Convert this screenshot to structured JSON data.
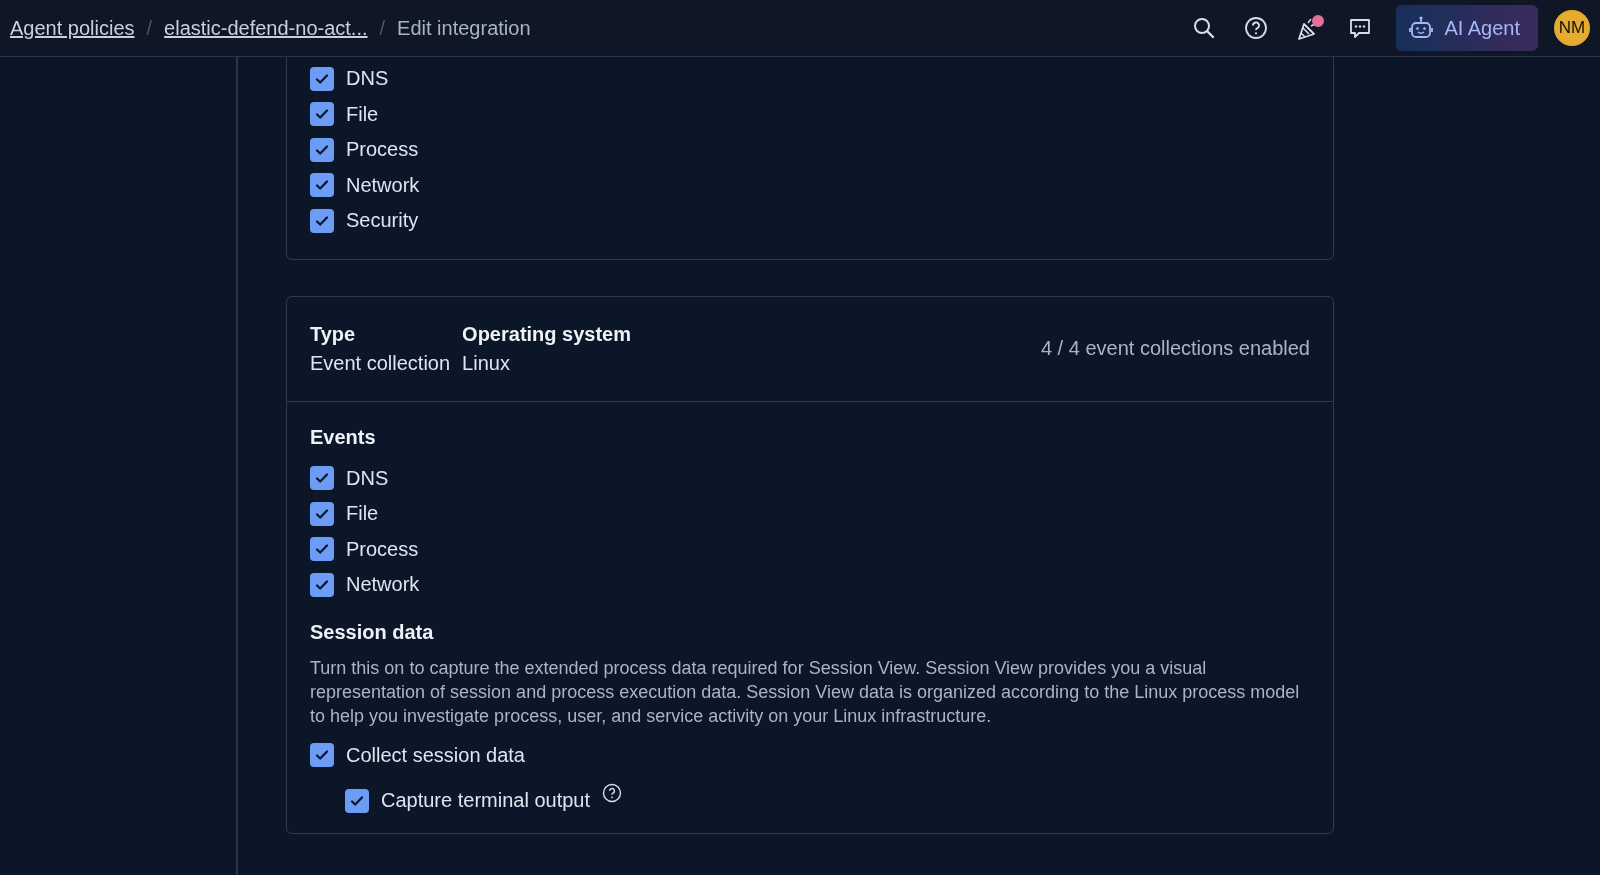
{
  "breadcrumbs": [
    {
      "label": "Agent policies",
      "kind": "link"
    },
    {
      "label": "/",
      "kind": "separator"
    },
    {
      "label": "elastic-defend-no-act...",
      "kind": "link"
    },
    {
      "label": "/",
      "kind": "separator"
    },
    {
      "label": "Edit integration",
      "kind": "current"
    }
  ],
  "header_actions": {
    "notification_dot": true,
    "ai_button": "AI Agent",
    "avatar": "NM"
  },
  "cards": [
    {
      "events": [
        {
          "label": "DNS",
          "checked": true
        },
        {
          "label": "File",
          "checked": true
        },
        {
          "label": "Process",
          "checked": true
        },
        {
          "label": "Network",
          "checked": true
        },
        {
          "label": "Security",
          "checked": true
        }
      ]
    },
    {
      "type_label": "Type",
      "type_value": "Event collection",
      "os_label": "Operating system",
      "os_value": "Linux",
      "summary": "4 / 4 event collections enabled",
      "events_title": "Events",
      "events": [
        {
          "label": "DNS",
          "checked": true
        },
        {
          "label": "File",
          "checked": true
        },
        {
          "label": "Process",
          "checked": true
        },
        {
          "label": "Network",
          "checked": true
        }
      ],
      "session": {
        "title": "Session data",
        "description": "Turn this on to capture the extended process data required for Session View. Session View provides you a visual representation of session and process execution data. Session View data is organized according to the Linux process model to help you investigate process, user, and service activity on your Linux infrastructure.",
        "collect": {
          "label": "Collect session data",
          "checked": true
        },
        "capture": {
          "label": "Capture terminal output",
          "checked": true
        }
      }
    }
  ]
}
